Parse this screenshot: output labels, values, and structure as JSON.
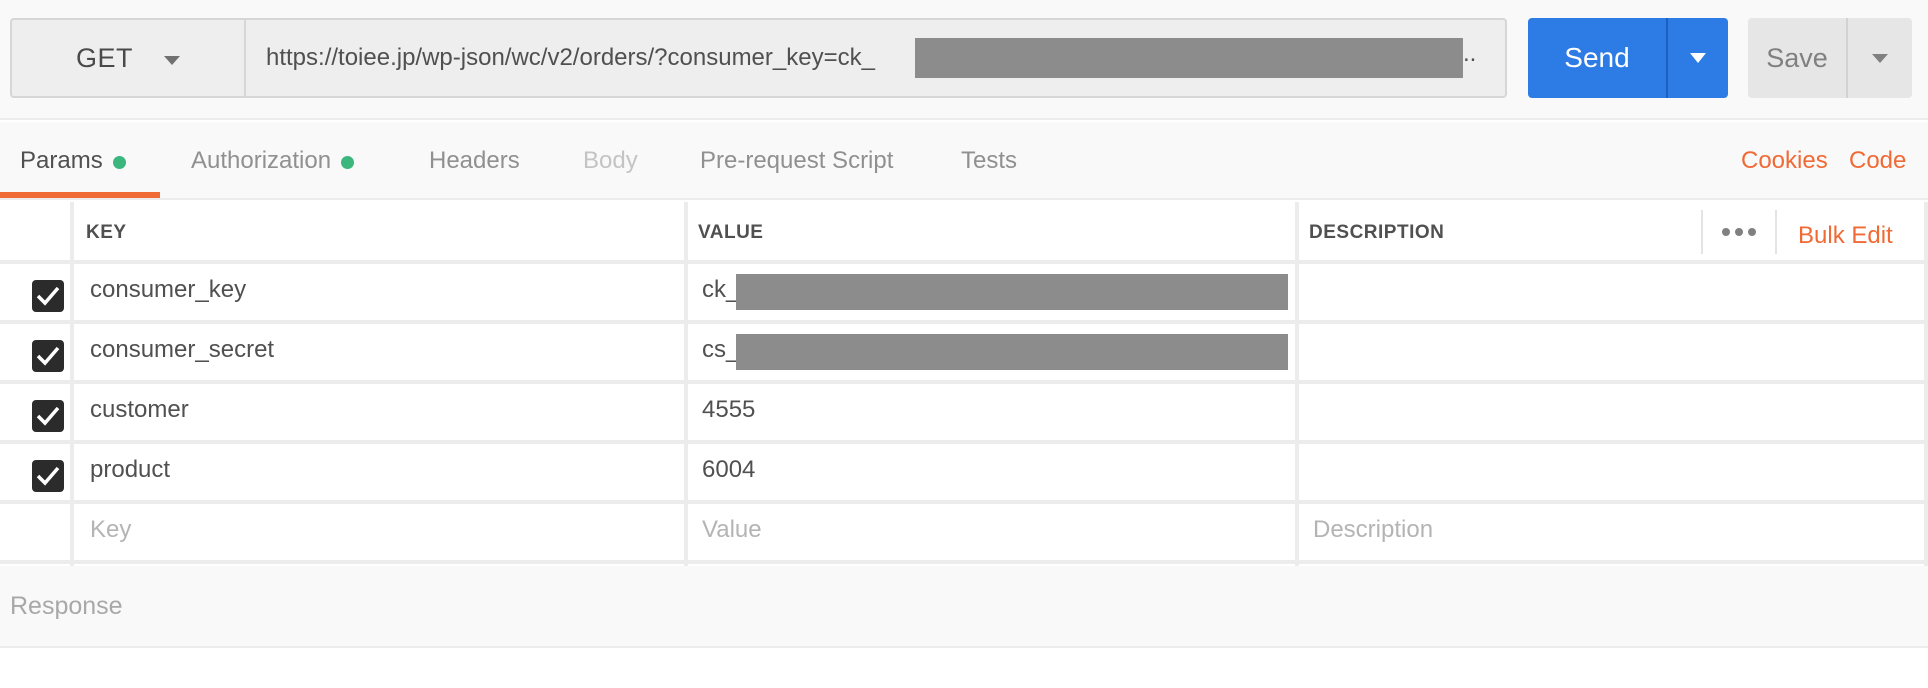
{
  "request": {
    "method": "GET",
    "url": "https://toiee.jp/wp-json/wc/v2/orders/?consumer_key=ck_",
    "url_ellipsis": "..",
    "send_label": "Send",
    "save_label": "Save"
  },
  "tabs": [
    {
      "label": "Params",
      "dot": true,
      "active": true
    },
    {
      "label": "Authorization",
      "dot": true
    },
    {
      "label": "Headers"
    },
    {
      "label": "Body",
      "disabled": true
    },
    {
      "label": "Pre-request Script"
    },
    {
      "label": "Tests"
    }
  ],
  "tab_links": {
    "cookies": "Cookies",
    "code": "Code"
  },
  "params": {
    "headers": {
      "key": "KEY",
      "value": "VALUE",
      "description": "DESCRIPTION"
    },
    "bulk_edit_label": "Bulk Edit",
    "rows": [
      {
        "key": "consumer_key",
        "value": "ck_",
        "checked": true,
        "value_redacted": true
      },
      {
        "key": "consumer_secret",
        "value": "cs_(",
        "checked": true,
        "value_redacted": true
      },
      {
        "key": "customer",
        "value": "4555",
        "checked": true
      },
      {
        "key": "product",
        "value": "6004",
        "checked": true
      }
    ],
    "placeholders": {
      "key": "Key",
      "value": "Value",
      "description": "Description"
    }
  },
  "response": {
    "label": "Response"
  },
  "colors": {
    "accent": "#f06a35",
    "send_button": "#2d7be5",
    "status_dot": "#3bb67d",
    "redaction": "#8c8c8c"
  },
  "icons": [
    "chevron-down-icon",
    "more-horizontal-icon",
    "checkmark-icon"
  ]
}
